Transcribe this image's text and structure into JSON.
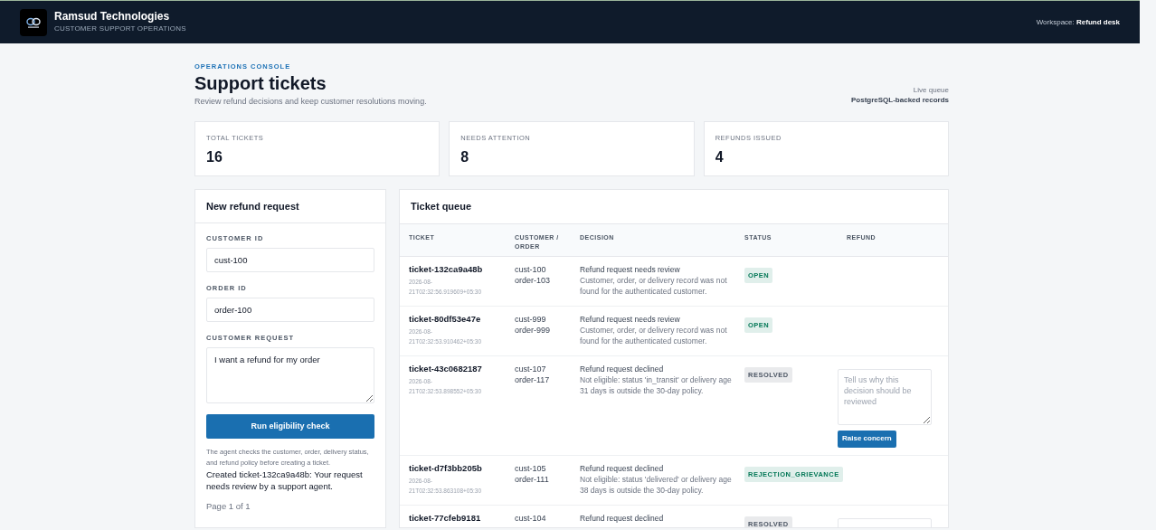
{
  "header": {
    "company": "Ramsud Technologies",
    "tagline": "CUSTOMER SUPPORT OPERATIONS",
    "workspace_label": "Workspace:",
    "workspace": "Refund desk"
  },
  "page": {
    "eyebrow": "OPERATIONS CONSOLE",
    "title": "Support tickets",
    "subtitle": "Review refund decisions and keep customer resolutions moving.",
    "source_label": "Live queue",
    "source": "PostgreSQL-backed records"
  },
  "stats": [
    {
      "label": "TOTAL TICKETS",
      "value": "16"
    },
    {
      "label": "NEEDS ATTENTION",
      "value": "8"
    },
    {
      "label": "REFUNDS ISSUED",
      "value": "4"
    }
  ],
  "form": {
    "title": "New refund request",
    "fields": [
      {
        "kind": "input",
        "label": "CUSTOMER ID",
        "value": "cust-100"
      },
      {
        "kind": "input",
        "label": "ORDER ID",
        "value": "order-100"
      },
      {
        "kind": "textarea",
        "label": "CUSTOMER REQUEST",
        "value": "I want a refund for my order"
      }
    ],
    "button": "Run eligibility check",
    "hint": "The agent checks the customer, order, delivery status, and refund policy before creating a ticket.",
    "result": "Created ticket-132ca9a48b: Your request needs review by a support agent.",
    "pagination": "Page 1 of 1"
  },
  "table": {
    "title": "Ticket queue",
    "columns": [
      "TICKET",
      "CUSTOMER / ORDER",
      "DECISION",
      "STATUS",
      "REFUND"
    ],
    "rows": [
      {
        "ticket": "ticket-132ca9a48b",
        "created": "2026-08-21T02:32:56.919609+05:30",
        "customer": "cust-100",
        "order": "order-103",
        "decision": "Refund request needs review",
        "reason": "Customer, order, or delivery record was not found for the authenticated customer.",
        "status": "OPEN",
        "color": "#047857"
      },
      {
        "ticket": "ticket-80df53e47e",
        "created": "2026-08-21T02:32:53.910462+05:30",
        "customer": "cust-999",
        "order": "order-999",
        "decision": "Refund request needs review",
        "reason": "Customer, order, or delivery record was not found for the authenticated customer.",
        "status": "OPEN",
        "color": "#047857"
      },
      {
        "ticket": "ticket-43c0682187",
        "created": "2026-08-21T02:32:53.898552+05:30",
        "customer": "cust-107",
        "order": "order-117",
        "decision": "Refund request declined",
        "reason": "Not eligible: status 'in_transit' or delivery age 31 days is outside the 30-day policy.",
        "status": "RESOLVED",
        "color": "#4b5563",
        "concern": {
          "placeholder": "Tell us why this decision should be reviewed",
          "button": "Raise concern"
        }
      },
      {
        "ticket": "ticket-d7f3bb205b",
        "created": "2026-08-21T02:32:53.863108+05:30",
        "customer": "cust-105",
        "order": "order-111",
        "decision": "Refund request declined",
        "reason": "Not eligible: status 'delivered' or delivery age 38 days is outside the 30-day policy.",
        "status": "REJECTION_GRIEVANCE",
        "color": "#047857"
      },
      {
        "ticket": "ticket-77cfeb9181",
        "customer": "cust-104",
        "decision": "Refund request declined",
        "status": "RESOLVED",
        "color": "#4b5563",
        "concern": {}
      }
    ]
  }
}
